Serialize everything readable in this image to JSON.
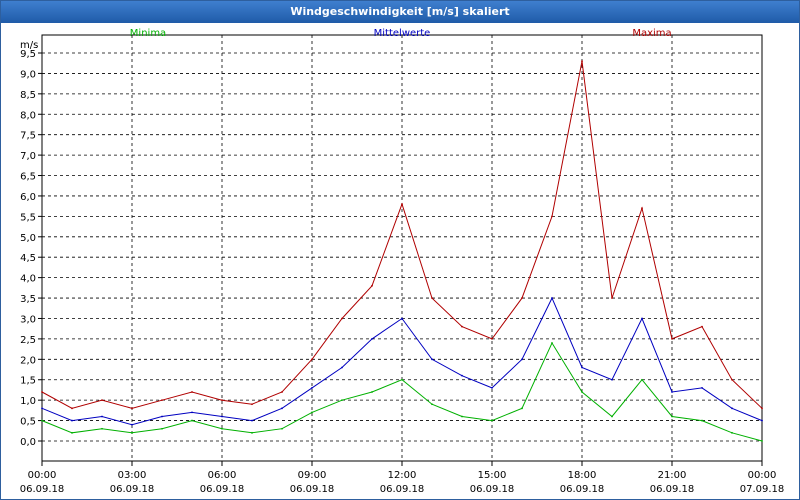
{
  "window": {
    "title": "Windgeschwindigkeit [m/s] skaliert"
  },
  "chart_data": {
    "type": "line",
    "title": "Windgeschwindigkeit [m/s] skaliert",
    "ylabel": "m/s",
    "ylim": [
      0,
      9.5
    ],
    "yticks": [
      "0,0",
      "0,5",
      "1,0",
      "1,5",
      "2,0",
      "2,5",
      "3,0",
      "3,5",
      "4,0",
      "4,5",
      "5,0",
      "5,5",
      "6,0",
      "6,5",
      "7,0",
      "7,5",
      "8,0",
      "8,5",
      "9,0",
      "9,5"
    ],
    "xlim": [
      0,
      24
    ],
    "xticks": [
      {
        "time": "00:00",
        "date": "06.09.18"
      },
      {
        "time": "03:00",
        "date": "06.09.18"
      },
      {
        "time": "06:00",
        "date": "06.09.18"
      },
      {
        "time": "09:00",
        "date": "06.09.18"
      },
      {
        "time": "12:00",
        "date": "06.09.18"
      },
      {
        "time": "15:00",
        "date": "06.09.18"
      },
      {
        "time": "18:00",
        "date": "06.09.18"
      },
      {
        "time": "21:00",
        "date": "06.09.18"
      },
      {
        "time": "00:00",
        "date": "07.09.18"
      }
    ],
    "grid": true,
    "legend_position": "top",
    "series": [
      {
        "name": "Minima",
        "color": "#00b000",
        "x": [
          0,
          1,
          2,
          3,
          4,
          5,
          6,
          7,
          8,
          9,
          10,
          11,
          12,
          13,
          14,
          15,
          16,
          17,
          18,
          19,
          20,
          21,
          22,
          23,
          24
        ],
        "values": [
          0.5,
          0.2,
          0.3,
          0.2,
          0.3,
          0.5,
          0.3,
          0.2,
          0.3,
          0.7,
          1.0,
          1.2,
          1.5,
          0.9,
          0.6,
          0.5,
          0.8,
          2.4,
          1.2,
          0.6,
          1.5,
          0.6,
          0.5,
          0.2,
          0.0
        ]
      },
      {
        "name": "Mittelwerte",
        "color": "#0000c0",
        "x": [
          0,
          1,
          2,
          3,
          4,
          5,
          6,
          7,
          8,
          9,
          10,
          11,
          12,
          13,
          14,
          15,
          16,
          17,
          18,
          19,
          20,
          21,
          22,
          23,
          24
        ],
        "values": [
          0.8,
          0.5,
          0.6,
          0.4,
          0.6,
          0.7,
          0.6,
          0.5,
          0.8,
          1.3,
          1.8,
          2.5,
          3.0,
          2.0,
          1.6,
          1.3,
          2.0,
          3.5,
          1.8,
          1.5,
          3.0,
          1.2,
          1.3,
          0.8,
          0.5
        ]
      },
      {
        "name": "Maxima",
        "color": "#b00000",
        "x": [
          0,
          1,
          2,
          3,
          4,
          5,
          6,
          7,
          8,
          9,
          10,
          11,
          12,
          13,
          14,
          15,
          16,
          17,
          18,
          19,
          20,
          21,
          22,
          23,
          24
        ],
        "values": [
          1.2,
          0.8,
          1.0,
          0.8,
          1.0,
          1.2,
          1.0,
          0.9,
          1.2,
          2.0,
          3.0,
          3.8,
          5.8,
          3.5,
          2.8,
          2.5,
          3.5,
          5.5,
          9.3,
          3.5,
          5.7,
          2.5,
          2.8,
          1.5,
          0.8
        ]
      }
    ]
  }
}
